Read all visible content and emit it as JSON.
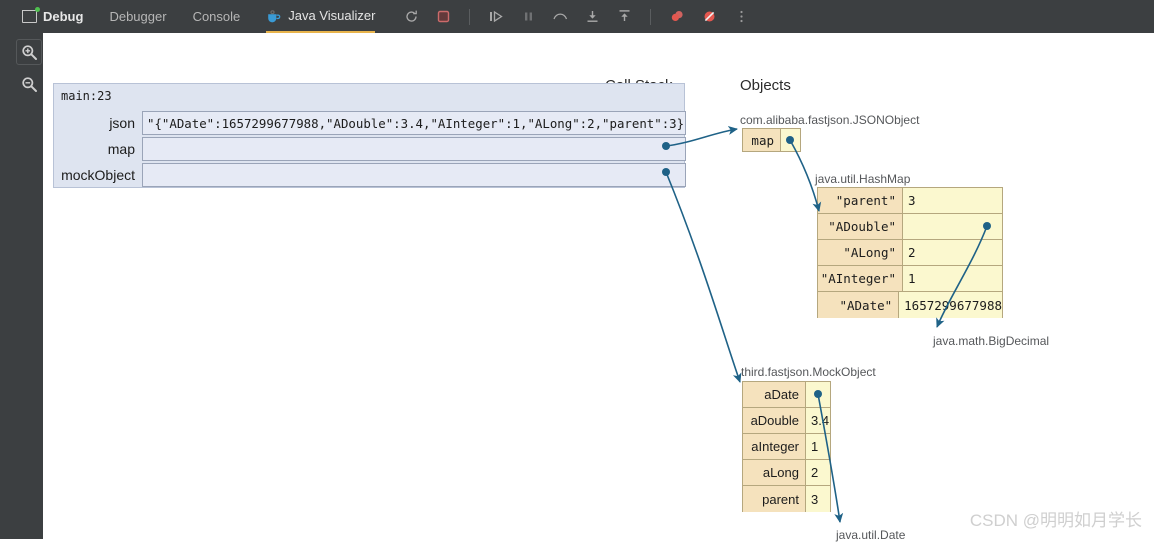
{
  "toolbar": {
    "window_title": "Debug",
    "tabs": [
      {
        "label": "Debugger",
        "active": false
      },
      {
        "label": "Console",
        "active": false
      },
      {
        "label": "Java Visualizer",
        "active": true
      }
    ],
    "buttons": [
      {
        "name": "rerun-icon",
        "label": "↻"
      },
      {
        "name": "stop-icon",
        "label": "■"
      },
      {
        "name": "resume-icon",
        "label": "▷"
      },
      {
        "name": "pause-icon",
        "label": "‖"
      },
      {
        "name": "step-over-icon",
        "label": "⌒"
      },
      {
        "name": "step-into-icon",
        "label": "↓"
      },
      {
        "name": "step-out-icon",
        "label": "↑"
      },
      {
        "name": "mute-breakpoints-icon",
        "label": "●"
      },
      {
        "name": "view-breakpoints-icon",
        "label": "⊘"
      },
      {
        "name": "more-options-icon",
        "label": "⋮"
      }
    ],
    "accent_underline": "#e8b44c",
    "background": "#3c3f41"
  },
  "gutter": {
    "zoom_in_label": "zoom-in",
    "zoom_out_label": "zoom-out"
  },
  "headings": {
    "call_stack": "Call Stack",
    "objects": "Objects"
  },
  "call_stack": {
    "frame_label": "main:23",
    "variables": [
      {
        "name": "json",
        "value": "\"{\"ADate\":1657299677988,\"ADouble\":3.4,\"AInteger\":1,\"ALong\":2,\"parent\":3}\"",
        "has_pointer": false
      },
      {
        "name": "map",
        "value": "",
        "has_pointer": true
      },
      {
        "name": "mockObject",
        "value": "",
        "has_pointer": true
      }
    ]
  },
  "objects": [
    {
      "id": "jsonobject",
      "type_label": "com.alibaba.fastjson.JSONObject",
      "font": "mono",
      "rows": [
        {
          "key": "map",
          "value": "",
          "has_pointer": true
        }
      ]
    },
    {
      "id": "hashmap",
      "type_label": "java.util.HashMap",
      "font": "mono",
      "rows": [
        {
          "key": "\"parent\"",
          "value": "3",
          "has_pointer": false
        },
        {
          "key": "\"ADouble\"",
          "value": "",
          "has_pointer": true
        },
        {
          "key": "\"ALong\"",
          "value": "2",
          "has_pointer": false
        },
        {
          "key": "\"AInteger\"",
          "value": "1",
          "has_pointer": false
        },
        {
          "key": "\"ADate\"",
          "value": "1657299677988",
          "has_pointer": false
        }
      ]
    },
    {
      "id": "mockobject",
      "type_label": "third.fastjson.MockObject",
      "font": "sans",
      "rows": [
        {
          "key": "aDate",
          "value": "",
          "has_pointer": true
        },
        {
          "key": "aDouble",
          "value": "3.4",
          "has_pointer": false
        },
        {
          "key": "aInteger",
          "value": "1",
          "has_pointer": false
        },
        {
          "key": "aLong",
          "value": "2",
          "has_pointer": false
        },
        {
          "key": "parent",
          "value": "3",
          "has_pointer": false
        }
      ]
    }
  ],
  "terminal_labels": [
    {
      "id": "bigdecimal",
      "text": "java.math.BigDecimal"
    },
    {
      "id": "utildate",
      "text": "java.util.Date"
    }
  ],
  "colors": {
    "wire": "#1f6287",
    "object_key_bg": "#f5e2bd",
    "object_value_bg": "#fbf8cf",
    "object_border": "#b5a77e",
    "frame_bg": "#dee4f0",
    "toolbar_bg": "#3c3f41",
    "accent": "#e8b44c"
  },
  "watermark": "CSDN @明明如月学长"
}
